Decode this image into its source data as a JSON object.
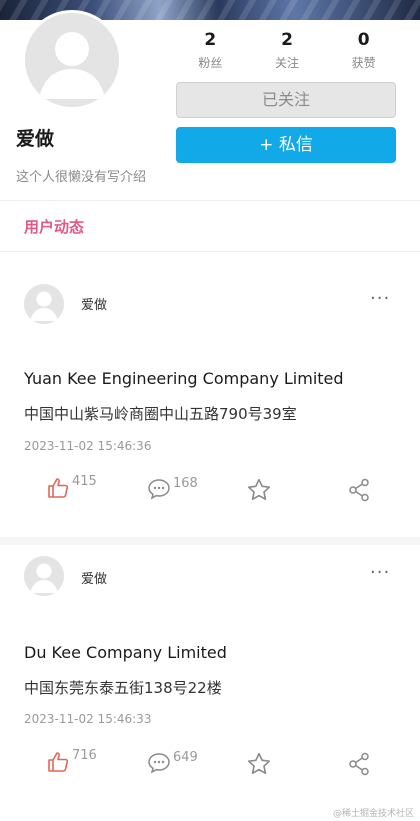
{
  "profile": {
    "name": "爱做",
    "bio": "这个人很懒没有写介绍",
    "stats": [
      {
        "value": "2",
        "label": "粉丝"
      },
      {
        "value": "2",
        "label": "关注"
      },
      {
        "value": "0",
        "label": "获赞"
      }
    ],
    "followed_label": "已关注",
    "message_label": "+ 私信"
  },
  "tabs": {
    "active": "用户动态"
  },
  "posts": [
    {
      "author": "爱做",
      "more": "···",
      "title": "Yuan Kee Engineering Company Limited",
      "body": "中国中山紫马岭商圈中山五路790号39室",
      "time": "2023-11-02 15:46:36",
      "likes": "415",
      "comments": "168"
    },
    {
      "author": "爱做",
      "more": "···",
      "title": "Du Kee Company Limited",
      "body": "中国东莞东泰五街138号22楼",
      "time": "2023-11-02 15:46:33",
      "likes": "716",
      "comments": "649"
    }
  ],
  "icons": {
    "like": "thumbs-up-icon",
    "comment": "comment-icon",
    "star": "star-icon",
    "share": "share-icon"
  },
  "colors": {
    "accent_pink": "#e05a86",
    "message_button": "#12a9e8",
    "like_icon": "#e0675a"
  },
  "watermark": "@稀土掘金技术社区"
}
